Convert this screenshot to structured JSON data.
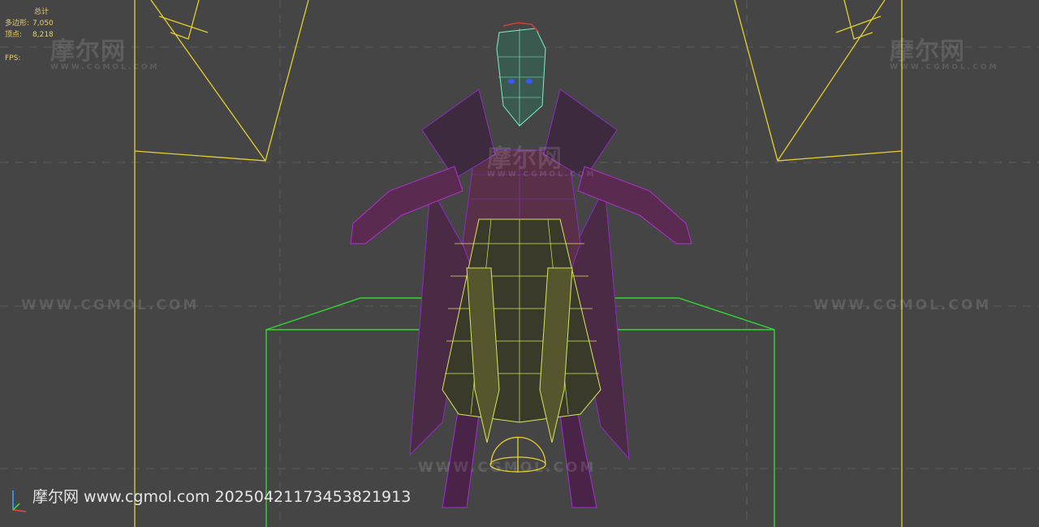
{
  "viewport": {
    "background": "#454545",
    "stats": {
      "header": "总计",
      "polygons_label": "多边形:",
      "polygons_value": "7,050",
      "vertices_label": "顶点:",
      "vertices_value": "8,218",
      "fps_label": "FPS:"
    },
    "watermark": {
      "logo_text": "摩尔网",
      "logo_sub": "WWW.CGMOL.COM",
      "url_text": "WWW.CGMOL.COM"
    },
    "caption": "摩尔网 www.cgmol.com 20250421173453821913",
    "colors": {
      "camera_lines": "#e6cf2e",
      "grid_box": "#33d633",
      "character_wire": "#8a2ec0",
      "armor_wire": "#d7e65a",
      "head_wire": "#7ef0c8",
      "skin": "#5a3048"
    },
    "icons": [
      "axis-gizmo-icon"
    ]
  }
}
